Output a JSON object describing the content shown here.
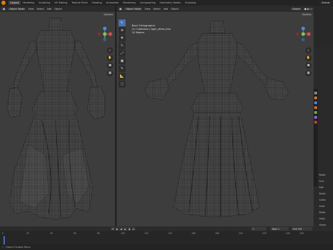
{
  "topbar": {
    "tabs": [
      "Layout",
      "Modeling",
      "Sculpting",
      "UV Editing",
      "Texture Paint",
      "Shading",
      "Animation",
      "Rendering",
      "Compositing",
      "Geometry Nodes",
      "Scripting"
    ],
    "scene": "Scene"
  },
  "left_viewport": {
    "mode": "Object Mode",
    "menus": [
      "View",
      "Select",
      "Add",
      "Object"
    ],
    "options": "Options"
  },
  "right_viewport": {
    "mode": "Object Mode",
    "menus": [
      "View",
      "Select",
      "Add",
      "Object"
    ],
    "transform": "Global",
    "options": "Options",
    "overlay_lines": [
      "Back Orthographic",
      "(1) Collection | tiger_dress_thin",
      "10 Meters"
    ]
  },
  "timeline": {
    "frame_numbers": [
      "0",
      "20",
      "40",
      "60",
      "80",
      "100",
      "120",
      "140",
      "160",
      "180",
      "200",
      "220",
      "240",
      "250"
    ],
    "current": "1",
    "start_label": "Start",
    "start": "1",
    "end_label": "End",
    "end": "250"
  },
  "statusbar": {
    "text": "Object Context Menu"
  },
  "props": {
    "items": [
      "Rotati",
      "Scal",
      "Delt",
      "Relati",
      "Collec",
      "Insta",
      "Motio",
      "Visibi",
      "Viewp",
      "Line",
      "Custo"
    ]
  },
  "colors": {
    "accent": "#4772b3",
    "blender_orange": "#e87d0d",
    "viewport_bg": "#3d3d3d",
    "x_axis": "#e04b4b",
    "y_axis": "#8bc34a",
    "z_axis": "#4a8bd9"
  }
}
